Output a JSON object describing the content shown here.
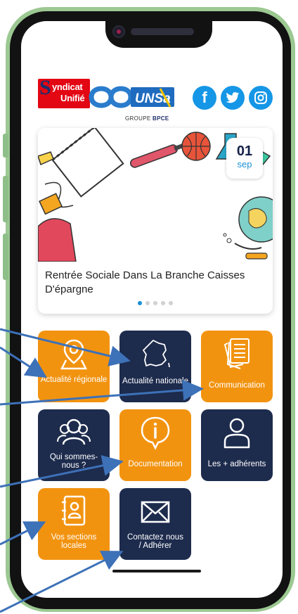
{
  "logo": {
    "letter": "S",
    "line1": "yndicat",
    "line2": "Unifié",
    "wordmark": "UNSa",
    "group_prefix": "GROUPE ",
    "group_name": "BPCE"
  },
  "social": [
    {
      "name": "facebook",
      "glyph": "f"
    },
    {
      "name": "twitter",
      "glyph": "t"
    },
    {
      "name": "instagram",
      "glyph": "ig"
    }
  ],
  "featured": {
    "date_day": "01",
    "date_month": "sep",
    "title": "Rentrée Sociale Dans La Branche Caisses D'épargne",
    "dots_total": 5,
    "dots_active": 1
  },
  "tiles": {
    "actualite_regionale": "Actualité régionale",
    "actualite_nationale": "Actualité nationale",
    "communication": "Communication",
    "qui_sommes_nous": "Qui sommes-nous ?",
    "documentation": "Documentation",
    "les_adherents": "Les + adhérents",
    "vos_sections_locales": "Vos sections locales",
    "contactez_nous": "Contactez nous / Adhérer"
  },
  "colors": {
    "orange": "#f29310",
    "navy": "#1d2b4d",
    "frame_green": "#9cc892",
    "accent_blue": "#1b8fd4",
    "arrow_blue": "#3d71b8"
  }
}
